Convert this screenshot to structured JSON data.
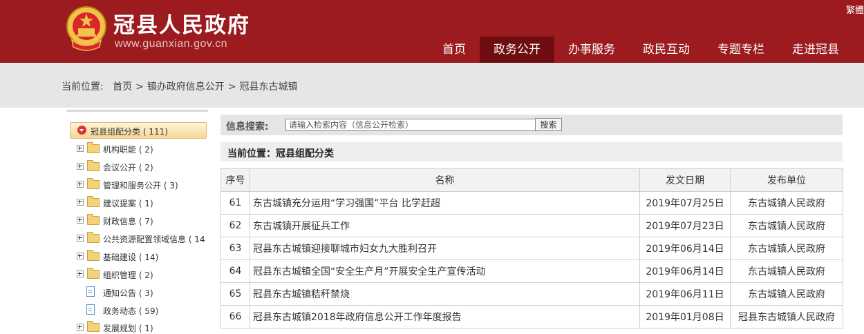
{
  "header": {
    "title": "冠县人民政府",
    "url": "www.guanxian.gov.cn",
    "lang_link": "繁體",
    "nav": [
      "首页",
      "政务公开",
      "办事服务",
      "政民互动",
      "专题专栏",
      "走进冠县"
    ],
    "active_nav": "政务公开"
  },
  "breadcrumb": {
    "label": "当前位置:",
    "items": [
      "首页",
      "镇办政府信息公开",
      "冠县东古城镇"
    ],
    "separator": ">"
  },
  "sidebar": {
    "root": "冠县组配分类 ( 111)",
    "items": [
      {
        "label": "机构职能 ( 2)",
        "type": "folder"
      },
      {
        "label": "会议公开 ( 2)",
        "type": "folder"
      },
      {
        "label": "管理和服务公开 ( 3)",
        "type": "folder"
      },
      {
        "label": "建议提案 ( 1)",
        "type": "folder"
      },
      {
        "label": "财政信息 ( 7)",
        "type": "folder"
      },
      {
        "label": "公共资源配置领域信息 ( 14",
        "type": "folder"
      },
      {
        "label": "基础建设 ( 14)",
        "type": "folder"
      },
      {
        "label": "组织管理 ( 2)",
        "type": "folder"
      },
      {
        "label": "通知公告 ( 3)",
        "type": "doc"
      },
      {
        "label": "政务动态 ( 59)",
        "type": "doc"
      },
      {
        "label": "发展规划 ( 1)",
        "type": "folder"
      }
    ]
  },
  "search": {
    "label": "信息搜索:",
    "placeholder": "请输入检索内容（信息公开检索）",
    "button": "搜索"
  },
  "current_position": "当前位置：冠县组配分类",
  "table": {
    "headers": [
      "序号",
      "名称",
      "发文日期",
      "发布单位"
    ],
    "rows": [
      {
        "no": "61",
        "title": "东古城镇充分运用“学习强国”平台 比学赶超",
        "date": "2019年07月25日",
        "unit": "东古城镇人民政府"
      },
      {
        "no": "62",
        "title": "东古城镇开展征兵工作",
        "date": "2019年07月23日",
        "unit": "东古城镇人民政府"
      },
      {
        "no": "63",
        "title": "冠县东古城镇迎接聊城市妇女九大胜利召开",
        "date": "2019年06月14日",
        "unit": "东古城镇人民政府"
      },
      {
        "no": "64",
        "title": "冠县东古城镇全国“安全生产月”开展安全生产宣传活动",
        "date": "2019年06月14日",
        "unit": "东古城镇人民政府"
      },
      {
        "no": "65",
        "title": "冠县东古城镇秸秆禁烧",
        "date": "2019年06月11日",
        "unit": "东古城镇人民政府"
      },
      {
        "no": "66",
        "title": "冠县东古城镇2018年政府信息公开工作年度报告",
        "date": "2019年01月08日",
        "unit": "冠县东古城镇人民政府"
      }
    ]
  },
  "colors": {
    "header_red": "#9b1b1f",
    "nav_active": "#6e0c0f",
    "emblem_gold": "#f2c24a"
  }
}
